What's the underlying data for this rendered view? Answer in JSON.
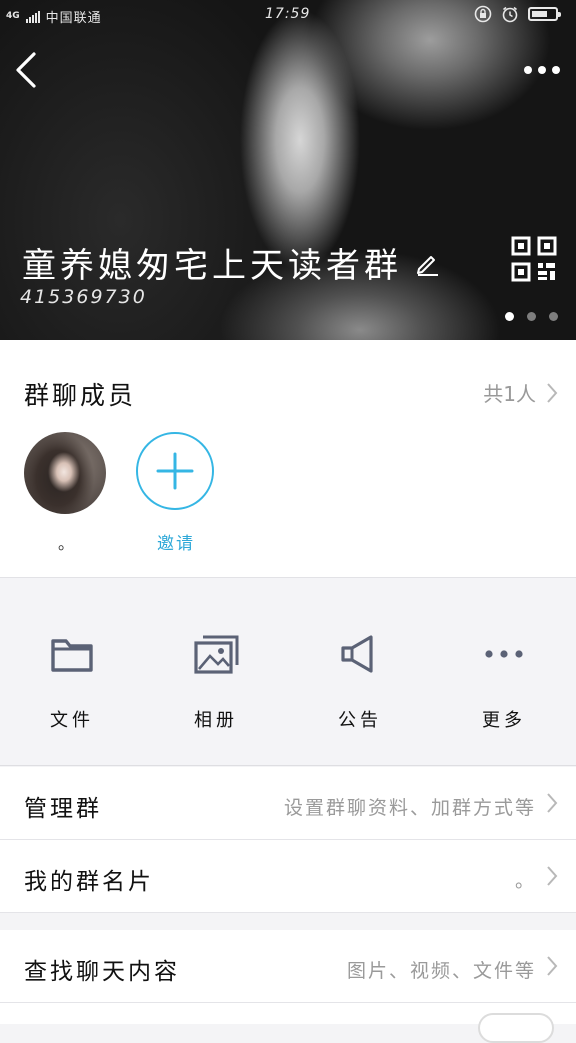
{
  "status_bar": {
    "network": "4G",
    "carrier": "中国联通",
    "time": "17:59",
    "battery_level": 0.7
  },
  "header": {
    "group_name": "童养媳匆宅上天读者群",
    "group_id": "415369730",
    "page_count": 3,
    "active_page": 0,
    "icons": [
      "back-arrow-icon",
      "more-dots-icon",
      "edit-pencil-icon",
      "qr-code-icon"
    ]
  },
  "members": {
    "title": "群聊成员",
    "count_text": "共1人",
    "list": [
      {
        "name": "。"
      }
    ],
    "invite_label": "邀请"
  },
  "actions": [
    {
      "label": "文件",
      "icon": "folder-icon"
    },
    {
      "label": "相册",
      "icon": "photo-album-icon"
    },
    {
      "label": "公告",
      "icon": "megaphone-icon"
    },
    {
      "label": "更多",
      "icon": "more-dots-icon"
    }
  ],
  "rows": [
    {
      "label": "管理群",
      "value": "设置群聊资料、加群方式等"
    },
    {
      "label": "我的群名片",
      "value": "。"
    },
    {
      "label": "查找聊天内容",
      "value": "图片、视频、文件等"
    }
  ],
  "colors": {
    "accent": "#35b6e4",
    "icon_gray": "#5b6276"
  }
}
